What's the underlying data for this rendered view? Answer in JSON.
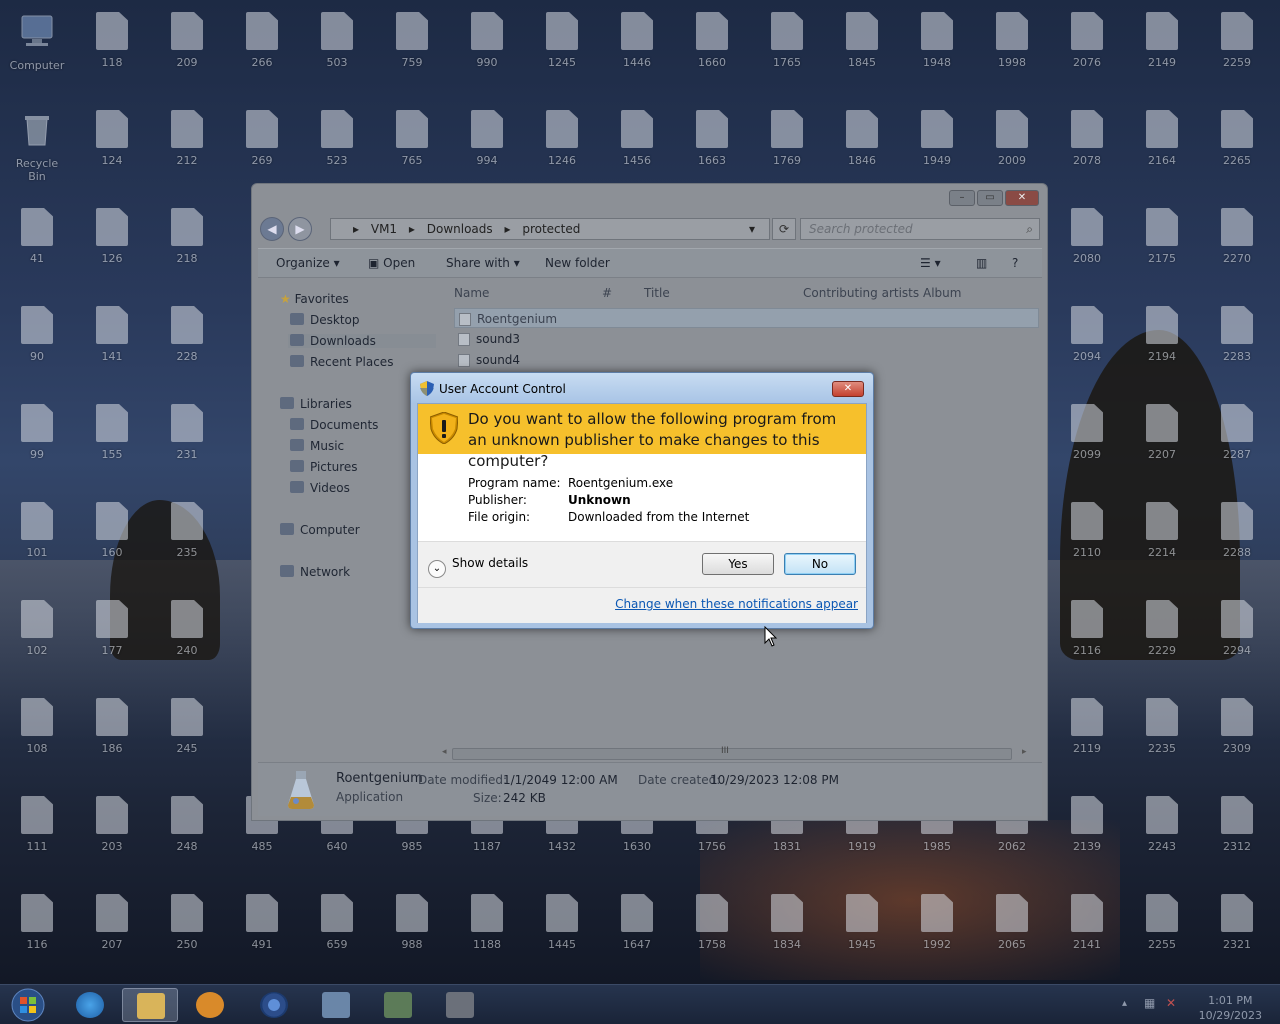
{
  "desktop": {
    "system_icons": [
      {
        "label": "Computer"
      },
      {
        "label": "Recycle Bin"
      }
    ],
    "file_icons": [
      "118",
      "209",
      "266",
      "503",
      "759",
      "990",
      "1245",
      "1446",
      "1660",
      "1765",
      "1845",
      "1948",
      "1998",
      "2076",
      "2149",
      "2259",
      "124",
      "212",
      "269",
      "523",
      "765",
      "994",
      "1246",
      "1456",
      "1663",
      "1769",
      "1846",
      "1949",
      "2009",
      "2078",
      "2164",
      "2265",
      "41",
      "126",
      "218",
      "2080",
      "2175",
      "2270",
      "90",
      "141",
      "228",
      "2094",
      "2194",
      "2283",
      "99",
      "155",
      "231",
      "2099",
      "2207",
      "2287",
      "101",
      "160",
      "235",
      "2110",
      "2214",
      "2288",
      "102",
      "177",
      "240",
      "2116",
      "2229",
      "2294",
      "108",
      "186",
      "245",
      "2119",
      "2235",
      "2309",
      "111",
      "203",
      "248",
      "485",
      "640",
      "985",
      "1187",
      "1432",
      "1630",
      "1756",
      "1831",
      "1919",
      "1985",
      "2062",
      "2139",
      "2243",
      "2312",
      "116",
      "207",
      "250",
      "491",
      "659",
      "988",
      "1188",
      "1445",
      "1647",
      "1758",
      "1834",
      "1945",
      "1992",
      "2065",
      "2141",
      "2255",
      "2321"
    ]
  },
  "explorer": {
    "breadcrumb": [
      "VM1",
      "Downloads",
      "protected"
    ],
    "search_placeholder": "Search protected",
    "toolbar": {
      "organize": "Organize",
      "open": "Open",
      "share_with": "Share with",
      "new_folder": "New folder"
    },
    "nav": {
      "favorites": "Favorites",
      "desktop": "Desktop",
      "downloads": "Downloads",
      "recent_places": "Recent Places",
      "libraries": "Libraries",
      "documents": "Documents",
      "music": "Music",
      "pictures": "Pictures",
      "videos": "Videos",
      "computer": "Computer",
      "network": "Network"
    },
    "columns": {
      "name": "Name",
      "number": "#",
      "title": "Title",
      "contributing_artists": "Contributing artists",
      "album": "Album"
    },
    "files": [
      {
        "name": "Roentgenium",
        "selected": true
      },
      {
        "name": "sound3",
        "selected": false
      },
      {
        "name": "sound4",
        "selected": false
      }
    ],
    "scroll_grip": "III",
    "status": {
      "name": "Roentgenium",
      "type": "Application",
      "date_modified_label": "Date modified:",
      "date_modified": "1/1/2049 12:00 AM",
      "date_created_label": "Date created:",
      "date_created": "10/29/2023 12:08 PM",
      "size_label": "Size:",
      "size": "242 KB"
    }
  },
  "uac": {
    "title": "User Account Control",
    "question": "Do you want to allow the following program from an unknown publisher to make changes to this computer?",
    "program_name_label": "Program name:",
    "program_name": "Roentgenium.exe",
    "publisher_label": "Publisher:",
    "publisher": "Unknown",
    "file_origin_label": "File origin:",
    "file_origin": "Downloaded from the Internet",
    "show_details": "Show details",
    "yes": "Yes",
    "no": "No",
    "change_link": "Change when these notifications appear"
  },
  "taskbar": {
    "time": "1:01 PM",
    "date": "10/29/2023",
    "apps": [
      "internet-explorer",
      "file-explorer",
      "media-player",
      "chrome",
      "control-panel",
      "network-center",
      "task-manager"
    ]
  },
  "colors": {
    "uac_banner": "#f6c02c",
    "link": "#0b57b3",
    "taskbar": "#1a2438"
  }
}
